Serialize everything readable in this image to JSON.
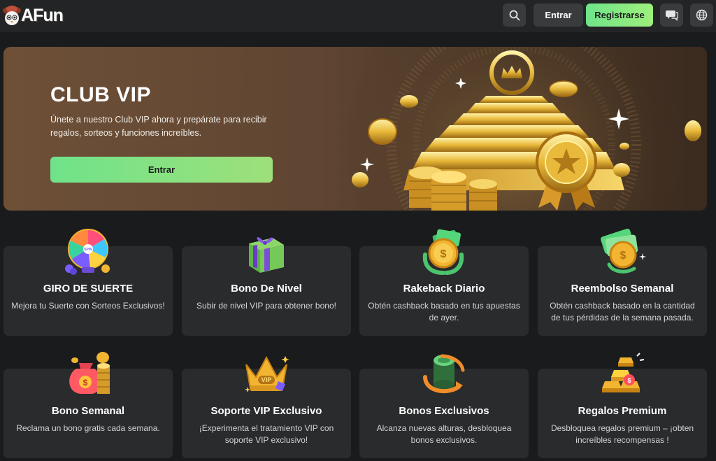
{
  "header": {
    "logo_text": "AFun",
    "login_label": "Entrar",
    "register_label": "Registrarse",
    "icons": [
      "search-icon",
      "chat-icon",
      "globe-icon"
    ]
  },
  "hero": {
    "title": "CLUB VIP",
    "description": "Únete a nuestro Club VIP ahora y prepárate para recibir regalos, sorteos y funciones increíbles.",
    "cta_label": "Entrar"
  },
  "cards": [
    {
      "title": "GIRO DE SUERTE",
      "desc": "Mejora tu Suerte con Sorteos Exclusivos!",
      "icon": "spin-wheel-icon"
    },
    {
      "title": "Bono De Nivel",
      "desc": "Subir de nivel VIP para obtener bono!",
      "icon": "gift-box-icon"
    },
    {
      "title": "Rakeback Diario",
      "desc": "Obtén cashback basado en tus apuestas de ayer.",
      "icon": "coin-cash-icon"
    },
    {
      "title": "Reembolso Semanal",
      "desc": "Obtén cashback basado en la cantidad de tus pérdidas de la semana pasada.",
      "icon": "cashback-money-icon"
    },
    {
      "title": "Bono Semanal",
      "desc": "Reclama un bono gratis cada semana.",
      "icon": "money-bag-icon"
    },
    {
      "title": "Soporte VIP Exclusivo",
      "desc": "¡Experimenta el tratamiento VIP con soporte VIP exclusivo!",
      "icon": "vip-crown-icon"
    },
    {
      "title": "Bonos Exclusivos",
      "desc": "Alcanza nuevas alturas, desbloquea bonos exclusivos.",
      "icon": "coin-stack-arrows-icon"
    },
    {
      "title": "Regalos Premium",
      "desc": "Desbloquea regalos premium – ¡obten increíbles recompensas !",
      "icon": "gold-bars-icon"
    }
  ],
  "colors": {
    "background": "#1a1b1c",
    "header": "#232425",
    "card": "#2a2b2d",
    "accent_green": "#6fe38a",
    "hero_brown": "#6e5037"
  }
}
